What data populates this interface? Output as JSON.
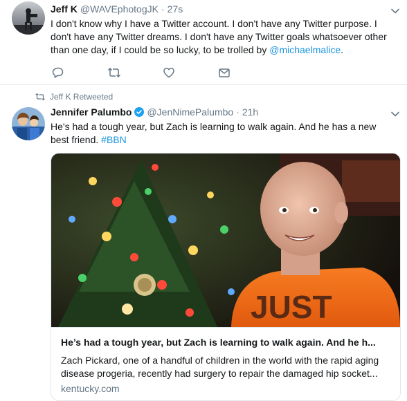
{
  "tweets": [
    {
      "name": "Jeff K",
      "handle": "@WAVEphotogJK",
      "separator": "·",
      "time": "27s",
      "text_plain": "I don't know why I have a Twitter account. I don't have any Twitter purpose. I don't have any Twitter dreams. I don't have any Twitter goals whatsoever other than one day, if I could be so lucky, to be trolled by ",
      "mention": "@michaelmalice",
      "text_end": "."
    },
    {
      "retweet_by": "Jeff K Retweeted",
      "name": "Jennifer Palumbo",
      "handle": "@JenNimePalumbo",
      "separator": "·",
      "time": "21h",
      "text_plain": "He's had a tough year, but Zach is learning to walk again. And he has a new best friend. ",
      "hashtag": "#BBN",
      "card": {
        "shirt_text": "JUST",
        "title": "He’s had a tough year, but Zach is learning to walk again. And he h...",
        "description": "Zach Pickard, one of a handful of children in the world with the rapid aging disease progeria, recently had surgery to repair the damaged hip socket...",
        "domain": "kentucky.com"
      }
    }
  ],
  "colors": {
    "accent": "#1b95e0",
    "muted": "#657786",
    "text": "#14171a",
    "divider": "#e6ecf0"
  },
  "icons": [
    "reply-icon",
    "retweet-icon",
    "like-icon",
    "message-icon",
    "chevron-down-icon",
    "verified-badge-icon"
  ]
}
